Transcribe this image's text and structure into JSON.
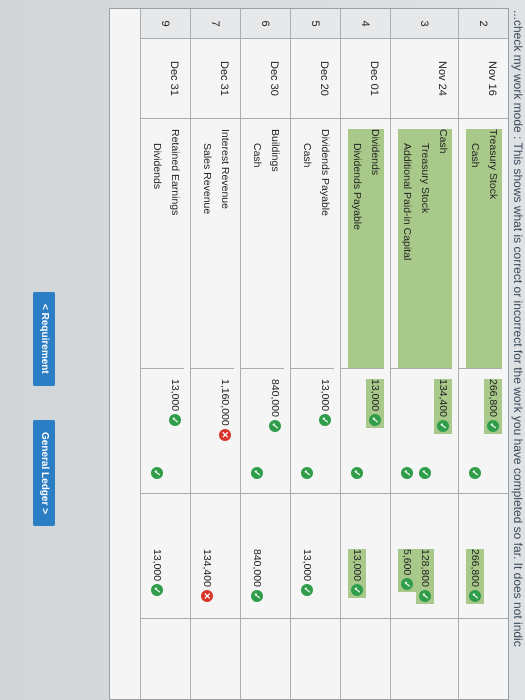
{
  "banner": "...check my work mode : This shows what is correct or incorrect for the work you have completed so far. It does not indic",
  "rows": [
    {
      "num": "2",
      "date": "Nov 16",
      "lines": [
        {
          "acct": "Treasury Stock",
          "credit": false,
          "debit": "266,800",
          "debit_mark": "check",
          "credit_amt": "",
          "credit_mark": "none",
          "hl": true
        },
        {
          "acct": "Cash",
          "credit": true,
          "debit": "",
          "debit_mark": "none",
          "credit_amt": "266,800",
          "credit_mark": "check",
          "hl": true
        }
      ]
    },
    {
      "num": "3",
      "date": "Nov 24",
      "lines": [
        {
          "acct": "Cash",
          "credit": false,
          "debit": "134,400",
          "debit_mark": "check",
          "credit_amt": "",
          "credit_mark": "none",
          "hl": true
        },
        {
          "acct": "Treasury Stock",
          "credit": true,
          "debit": "",
          "debit_mark": "none",
          "credit_amt": "128,800",
          "credit_mark": "check",
          "hl": true
        },
        {
          "acct": "Additional Paid-in Capital",
          "credit": true,
          "debit": "",
          "debit_mark": "none",
          "credit_amt": "5,600",
          "credit_mark": "check",
          "hl": true
        }
      ]
    },
    {
      "num": "4",
      "date": "Dec 01",
      "lines": [
        {
          "acct": "Dividends",
          "credit": false,
          "debit": "13,000",
          "debit_mark": "check",
          "credit_amt": "",
          "credit_mark": "none",
          "hl": true
        },
        {
          "acct": "Dividends Payable",
          "credit": true,
          "debit": "",
          "debit_mark": "none",
          "credit_amt": "13,000",
          "credit_mark": "check",
          "hl": true
        }
      ]
    },
    {
      "num": "5",
      "date": "Dec 20",
      "lines": [
        {
          "acct": "Dividends Payable",
          "credit": false,
          "debit": "13,000",
          "debit_mark": "check",
          "credit_amt": "",
          "credit_mark": "none",
          "hl": false
        },
        {
          "acct": "Cash",
          "credit": true,
          "debit": "",
          "debit_mark": "none",
          "credit_amt": "13,000",
          "credit_mark": "check",
          "hl": false
        }
      ]
    },
    {
      "num": "6",
      "date": "Dec 30",
      "lines": [
        {
          "acct": "Buildings",
          "credit": false,
          "debit": "840,000",
          "debit_mark": "check",
          "credit_amt": "",
          "credit_mark": "none",
          "hl": false
        },
        {
          "acct": "Cash",
          "credit": true,
          "debit": "",
          "debit_mark": "none",
          "credit_amt": "840,000",
          "credit_mark": "check",
          "hl": false
        }
      ]
    },
    {
      "num": "7",
      "date": "Dec 31",
      "lines": [
        {
          "acct": "Interest Revenue",
          "credit": false,
          "debit": "1,160,000",
          "debit_mark": "x",
          "credit_amt": "",
          "credit_mark": "none",
          "hl": false
        },
        {
          "acct": "Sales Revenue",
          "credit": true,
          "debit": "",
          "debit_mark": "none",
          "credit_amt": "134,400",
          "credit_mark": "x",
          "hl": false
        }
      ]
    },
    {
      "num": "9",
      "date": "Dec 31",
      "lines": [
        {
          "acct": "Retained Earnings",
          "credit": false,
          "debit": "13,000",
          "debit_mark": "check",
          "credit_amt": "",
          "credit_mark": "none",
          "hl": false
        },
        {
          "acct": "Dividends",
          "credit": true,
          "debit": "",
          "debit_mark": "none",
          "credit_amt": "13,000",
          "credit_mark": "check",
          "hl": false
        }
      ]
    }
  ],
  "buttons": {
    "prev": "< Requirement",
    "next": "General Ledger >"
  }
}
